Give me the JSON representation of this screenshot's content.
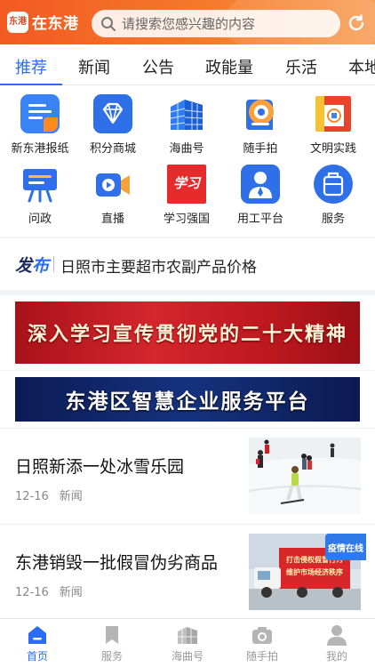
{
  "header": {
    "logo_badge": "东港",
    "app_name": "在东港",
    "search_placeholder": "请搜索您感兴趣的内容"
  },
  "tabs": [
    {
      "label": "推荐",
      "active": true
    },
    {
      "label": "新闻"
    },
    {
      "label": "公告"
    },
    {
      "label": "政能量"
    },
    {
      "label": "乐活"
    },
    {
      "label": "本地"
    }
  ],
  "grid": [
    {
      "label": "新东港报纸",
      "icon": "newspaper-icon"
    },
    {
      "label": "积分商城",
      "icon": "diamond-icon"
    },
    {
      "label": "海曲号",
      "icon": "building-icon"
    },
    {
      "label": "随手拍",
      "icon": "camera-icon"
    },
    {
      "label": "文明实践",
      "icon": "civilization-icon"
    },
    {
      "label": "问政",
      "icon": "podium-icon"
    },
    {
      "label": "直播",
      "icon": "video-icon"
    },
    {
      "label": "学习强国",
      "icon": "xuexi-icon",
      "logo_text": "学习"
    },
    {
      "label": "用工平台",
      "icon": "worker-icon"
    },
    {
      "label": "服务",
      "icon": "briefcase-icon"
    }
  ],
  "notice": {
    "tag_a": "发",
    "tag_b": "布",
    "text": "日照市主要超市农副产品价格"
  },
  "banners": [
    {
      "text": "深入学习宣传贯彻党的二十大精神"
    },
    {
      "text": "东港区智慧企业服务平台"
    }
  ],
  "news": [
    {
      "title": "日照新添一处冰雪乐园",
      "date": "12-16",
      "category": "新闻"
    },
    {
      "title": "东港销毁一批假冒伪劣商品",
      "date": "12-16",
      "category": "新闻",
      "thumb_badge": "疫情在线",
      "truck_text_1": "打击侵权假冒行为",
      "truck_text_2": "维护市场经济秩序"
    }
  ],
  "bottom_nav": [
    {
      "label": "首页",
      "active": true
    },
    {
      "label": "服务"
    },
    {
      "label": "海曲号"
    },
    {
      "label": "随手拍"
    },
    {
      "label": "我的"
    }
  ],
  "colors": {
    "accent": "#2a6df4",
    "header_orange": "#f25a22"
  }
}
